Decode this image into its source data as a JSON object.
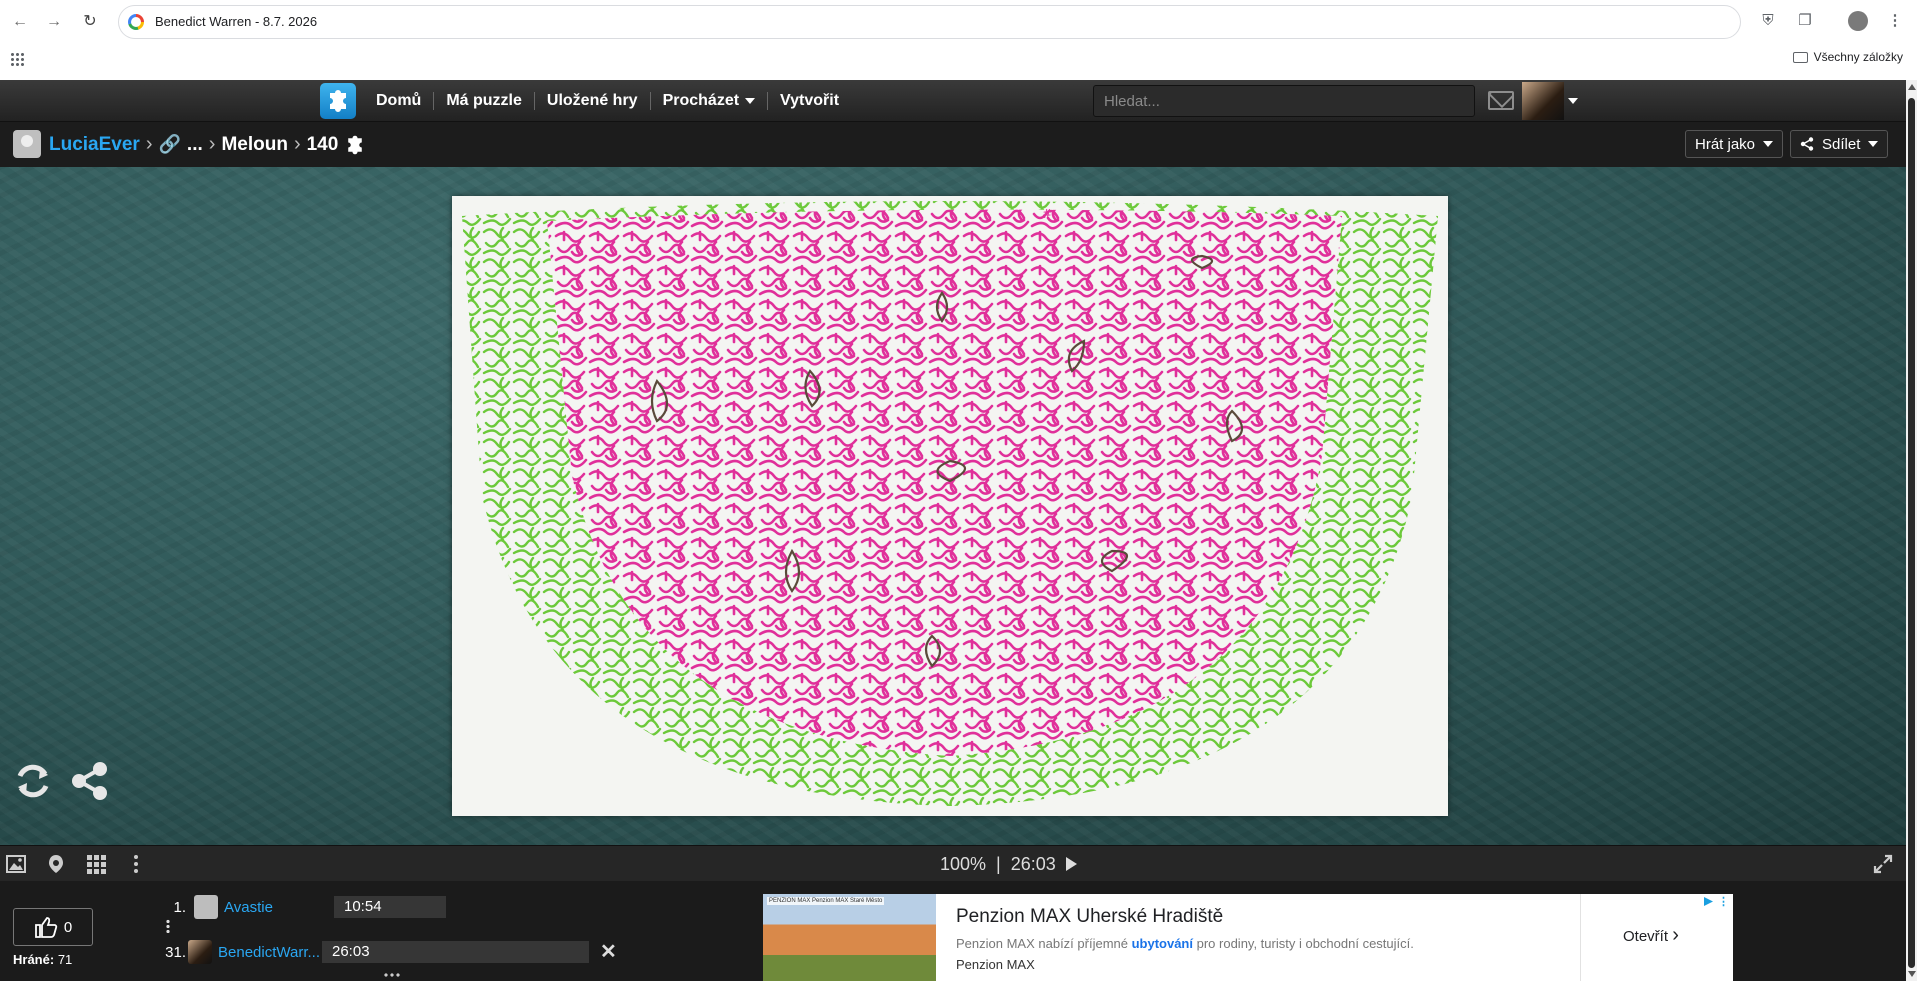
{
  "browser": {
    "address": "Benedict Warren - 8.7. 2026",
    "bookmarks_all": "Všechny záložky"
  },
  "nav": {
    "items": [
      "Domů",
      "Má puzzle",
      "Uložené hry",
      "Procházet",
      "Vytvořit"
    ],
    "search_placeholder": "Hledat..."
  },
  "breadcrumb": {
    "user": "LuciaEver",
    "ellipsis": "...",
    "puzzle": "Meloun",
    "pieces": "140"
  },
  "actions": {
    "play_as": "Hrát jako",
    "share": "Sdílet"
  },
  "status": {
    "zoom": "100%",
    "divider": "|",
    "timer": "26:03"
  },
  "footer": {
    "likes": "0",
    "played_label": "Hráné:",
    "played_count": "71",
    "leaderboard": [
      {
        "rank": "1.",
        "name": "Avastie",
        "time": "10:54"
      },
      {
        "rank": "31.",
        "name": "BenedictWarr...",
        "time": "26:03"
      }
    ]
  },
  "ad": {
    "image_caption": "PENZION MAX  Penzion MAX Staré Město",
    "title": "Penzion MAX Uherské Hradiště",
    "desc_before": "Penzion MAX nabízí příjemné ",
    "desc_highlight": "ubytování",
    "desc_after": " pro rodiny, turisty i obchodní cestující.",
    "brand": "Penzion MAX",
    "cta": "Otevřít"
  },
  "colors": {
    "accent_blue": "#2aa7f2",
    "maze_pink": "#e0309a",
    "maze_green": "#6cc93a",
    "play_bg": "#2e5656"
  }
}
